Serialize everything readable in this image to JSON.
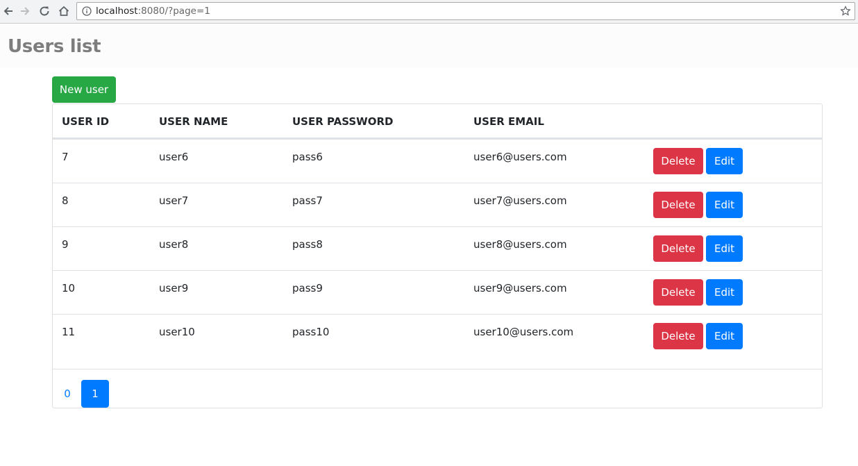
{
  "browser": {
    "url_host": "localhost",
    "url_rest": ":8080/?page=1"
  },
  "header": {
    "title": "Users list"
  },
  "toolbar": {
    "new_user_label": "New user"
  },
  "table": {
    "columns": [
      "USER ID",
      "USER NAME",
      "USER PASSWORD",
      "USER EMAIL"
    ],
    "rows": [
      {
        "id": "7",
        "name": "user6",
        "password": "pass6",
        "email": "user6@users.com"
      },
      {
        "id": "8",
        "name": "user7",
        "password": "pass7",
        "email": "user7@users.com"
      },
      {
        "id": "9",
        "name": "user8",
        "password": "pass8",
        "email": "user8@users.com"
      },
      {
        "id": "10",
        "name": "user9",
        "password": "pass9",
        "email": "user9@users.com"
      },
      {
        "id": "11",
        "name": "user10",
        "password": "pass10",
        "email": "user10@users.com"
      }
    ],
    "delete_label": "Delete",
    "edit_label": "Edit"
  },
  "pagination": {
    "pages": [
      "0",
      "1"
    ],
    "active": "1"
  },
  "colors": {
    "success": "#28a745",
    "danger": "#dc3545",
    "primary": "#007bff"
  }
}
